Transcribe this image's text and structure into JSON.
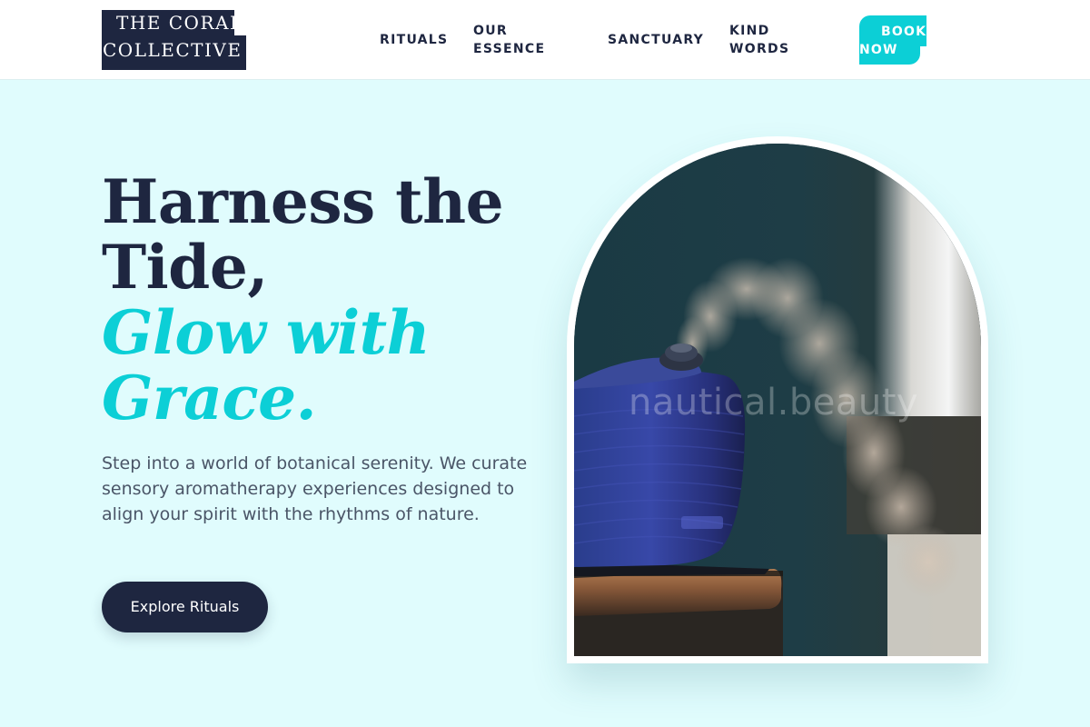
{
  "brand": {
    "line1": "THE CORAL",
    "line2": "COLLECTIVE"
  },
  "nav": {
    "rituals": "RITUALS",
    "essence_line1": "OUR",
    "essence_line2": "ESSENCE",
    "sanctuary": "SANCTUARY",
    "kind_line1": "KIND",
    "kind_line2": "WORDS",
    "book_line1": "BOOK",
    "book_line2": "NOW"
  },
  "hero": {
    "title_line1": "Harness the",
    "title_line2": "Tide,",
    "accent_line1": "Glow with",
    "accent_line2": "Grace.",
    "description": "Step into a world of botanical serenity. We curate sensory aromatherapy experiences designed to align your spirit with the rhythms of nature.",
    "cta_label": "Explore Rituals"
  },
  "image": {
    "watermark": "nautical.beauty",
    "subject": "aromatherapy diffuser with rising mist"
  },
  "colors": {
    "navy": "#1e2640",
    "accent_teal": "#0ccfd6",
    "page_background": "#e0fcfd",
    "body_text": "#4a5567"
  }
}
